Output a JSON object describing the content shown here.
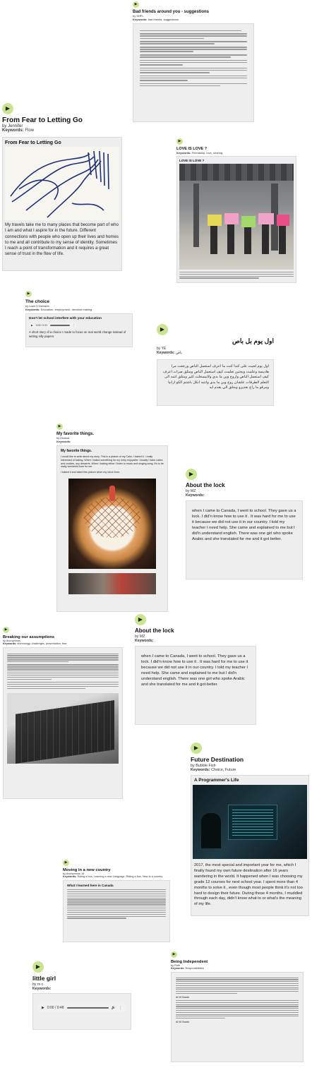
{
  "stories": {
    "bad_friends": {
      "title": "Bad friends around you - suggestions",
      "author": "by SHFL",
      "keywords_label": "Keywords:",
      "keywords": "bad friends, suggestions"
    },
    "fear": {
      "title": "From Fear to Letting Go",
      "author": "by Jennifer",
      "keywords_label": "Keywords:",
      "keywords": "Flow",
      "image_title": "From Fear to Letting Go",
      "text": "My travels take me to many places that become part of who I am and what I aspire for in the future. Different connections with people who open up their lives and homes to me and all contribute to my sense of identity. Sometimes I reach a point of transformation and it requires a great sense of trust in the flow of life."
    },
    "love": {
      "title": "LOVE IS LOVE ?",
      "author": "by Lily",
      "keywords_label": "Keywords:",
      "keywords": "Friendship, love, sharing",
      "image_label": "LOVE IS LOVE ?"
    },
    "choice": {
      "title": "The choice",
      "author": "by Liam D'Gehalen",
      "keywords_label": "Keywords:",
      "keywords": "Education, employment, decision making",
      "heading": "Don't let school interfere with your education",
      "time": "0:00 / 0:31",
      "text": "A short story of a choice I made to focus on real world change instead of writing silly papers."
    },
    "arabic": {
      "title": "اول يوم بل باص",
      "author": "by YE",
      "keywords_label": "Keywords:",
      "keywords": "باص",
      "text": "اول يوم لجيت على كندا كنت ما اعرف استعمل الباص ورجعت مرا هاديسة وعلمت ويحتين تعلمت كيف استعمل الباص ومتلق صرات اعرف كيف استعمل الباص واروح وين ما بدي ولاتيسخلت كثير ومتلق انتبه الى التعلم الطرقات علشان روح وين ما بدي وانتبه انكل باشتم الكو ارانيا ومرقو ما راح بغديرو ومتلق الي يقدم ايه"
    },
    "favorite": {
      "title": "My favorite things.",
      "author": "by Mulima",
      "keywords_label": "Keywords:",
      "keywords": "",
      "heading": "My favorite things.",
      "text1": "I would like to write about my story. This is a picture of my Cake, I baked it. I really interested of baking. When I baked something for my entry enjoyable. Usually I bake cakes and cookies, any desserts. When I baking either I listen to music and singing song. It's to be really wonderful time for me.",
      "text2": "I baked it and taked this picture when my niece born."
    },
    "lock1": {
      "title": "About the lock",
      "author": "by MZ",
      "keywords_label": "Keywords:",
      "keywords": "",
      "text": "when I came to Canada, I went to school. They gave us a lock. I did'n know how to use it . It was hard for me to use it because we did not use it in our country. I told my teacher I need help. She came and explained to me but I did'n understand english. There was one girl who spoke Arabic and she translated for me and it got better."
    },
    "assumptions": {
      "title": "Breaking our assumptions",
      "author": "by Anonymous",
      "keywords_label": "Keywords:",
      "keywords": "technology, challenges, presentation, fear"
    },
    "lock2": {
      "title": "About the lock",
      "author": "by MZ",
      "keywords_label": "Keywords:",
      "keywords": "",
      "text": "when I came to Canada, I went to school. They gave us a lock. I did'n know how to use it . It was hard for me to use it because we did not use it in our country. I told my teacher I need help. She came and explained to me but I did'n understand english. There was one girl who spoke Arabic and she translated for me and it got better."
    },
    "future": {
      "title": "Future Destination",
      "author": "by Bubble Fish",
      "keywords_label": "Keywords:",
      "keywords": "Choice, Future",
      "image_title": "A Programmer's Life",
      "text": "2017, the most special and important year for me, which I finally found my own future destination after 16 years wandering in the world. It happened when I was choosing my grade 12 courses for next school year. I spent more than 4 months to solve it , even though most people think it's not too hard to design their future. During those 4 months, I muddled through each day, didn't know what to or what's the meaning of my life."
    },
    "moving": {
      "title": "Moving in a new country",
      "author": "by Anonymous 16",
      "keywords_label": "Keywords:",
      "keywords": "Riding a bus, Learning a new Language, Riding a bus, New to a country",
      "heading": "What I learned here in Canada"
    },
    "little_girl": {
      "title": "little girl",
      "author": "by m.c",
      "keywords_label": "Keywords:",
      "keywords": "",
      "time": "0:00 / 0:48"
    },
    "independent": {
      "title": "Being Independent",
      "author": "by Ruth",
      "keywords_label": "Keywords:",
      "keywords": "Responsibilities",
      "sig1": "Ai Ni Osada",
      "sig2": "Ai Ni Osada"
    }
  },
  "icons": {
    "speaker": "speaker-icon",
    "play": "play-icon",
    "volume": "volume-icon",
    "more": "more-icon"
  },
  "colors": {
    "speaker_bg": "#c9e58f",
    "card_bg": "#eeeeee"
  }
}
